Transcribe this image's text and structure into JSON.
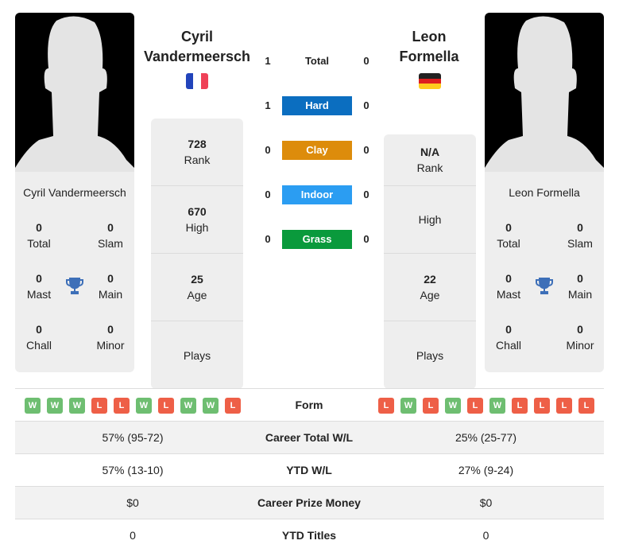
{
  "player1": {
    "name_line1": "Cyril",
    "name_line2": "Vandermeersch",
    "card_name": "Cyril Vandermeersch",
    "flag": "France",
    "flag_colors": [
      "#2244bb",
      "#ffffff",
      "#ef4157"
    ],
    "titles": {
      "total": {
        "value": "0",
        "label": "Total"
      },
      "slam": {
        "value": "0",
        "label": "Slam"
      },
      "mast": {
        "value": "0",
        "label": "Mast"
      },
      "main": {
        "value": "0",
        "label": "Main"
      },
      "chall": {
        "value": "0",
        "label": "Chall"
      },
      "minor": {
        "value": "0",
        "label": "Minor"
      }
    },
    "stats": [
      {
        "value": "728",
        "label": "Rank"
      },
      {
        "value": "670",
        "label": "High"
      },
      {
        "value": "25",
        "label": "Age"
      },
      {
        "value": "",
        "label": "Plays"
      }
    ]
  },
  "player2": {
    "name_line1": "Leon",
    "name_line2": "Formella",
    "card_name": "Leon Formella",
    "flag": "Germany",
    "flag_colors": [
      "#222222",
      "#dd1f1f",
      "#ffcc1e"
    ],
    "titles": {
      "total": {
        "value": "0",
        "label": "Total"
      },
      "slam": {
        "value": "0",
        "label": "Slam"
      },
      "mast": {
        "value": "0",
        "label": "Mast"
      },
      "main": {
        "value": "0",
        "label": "Main"
      },
      "chall": {
        "value": "0",
        "label": "Chall"
      },
      "minor": {
        "value": "0",
        "label": "Minor"
      }
    },
    "stats": [
      {
        "value": "N/A",
        "label": "Rank"
      },
      {
        "value": "",
        "label": "High"
      },
      {
        "value": "22",
        "label": "Age"
      },
      {
        "value": "",
        "label": "Plays"
      }
    ]
  },
  "h2h": [
    {
      "label": "Total",
      "p1": "1",
      "p2": "0",
      "color": ""
    },
    {
      "label": "Hard",
      "p1": "1",
      "p2": "0",
      "color": "#0b6ec0"
    },
    {
      "label": "Clay",
      "p1": "0",
      "p2": "0",
      "color": "#dd8c0b"
    },
    {
      "label": "Indoor",
      "p1": "0",
      "p2": "0",
      "color": "#2b9df2"
    },
    {
      "label": "Grass",
      "p1": "0",
      "p2": "0",
      "color": "#0a9a3c"
    }
  ],
  "form": {
    "label": "Form",
    "p1": [
      "W",
      "W",
      "W",
      "L",
      "L",
      "W",
      "L",
      "W",
      "W",
      "L"
    ],
    "p2": [
      "L",
      "W",
      "L",
      "W",
      "L",
      "W",
      "L",
      "L",
      "L",
      "L"
    ]
  },
  "comparison": [
    {
      "label": "Career Total W/L",
      "p1": "57% (95-72)",
      "p2": "25% (25-77)"
    },
    {
      "label": "YTD W/L",
      "p1": "57% (13-10)",
      "p2": "27% (9-24)"
    },
    {
      "label": "Career Prize Money",
      "p1": "$0",
      "p2": "$0"
    },
    {
      "label": "YTD Titles",
      "p1": "0",
      "p2": "0"
    }
  ]
}
